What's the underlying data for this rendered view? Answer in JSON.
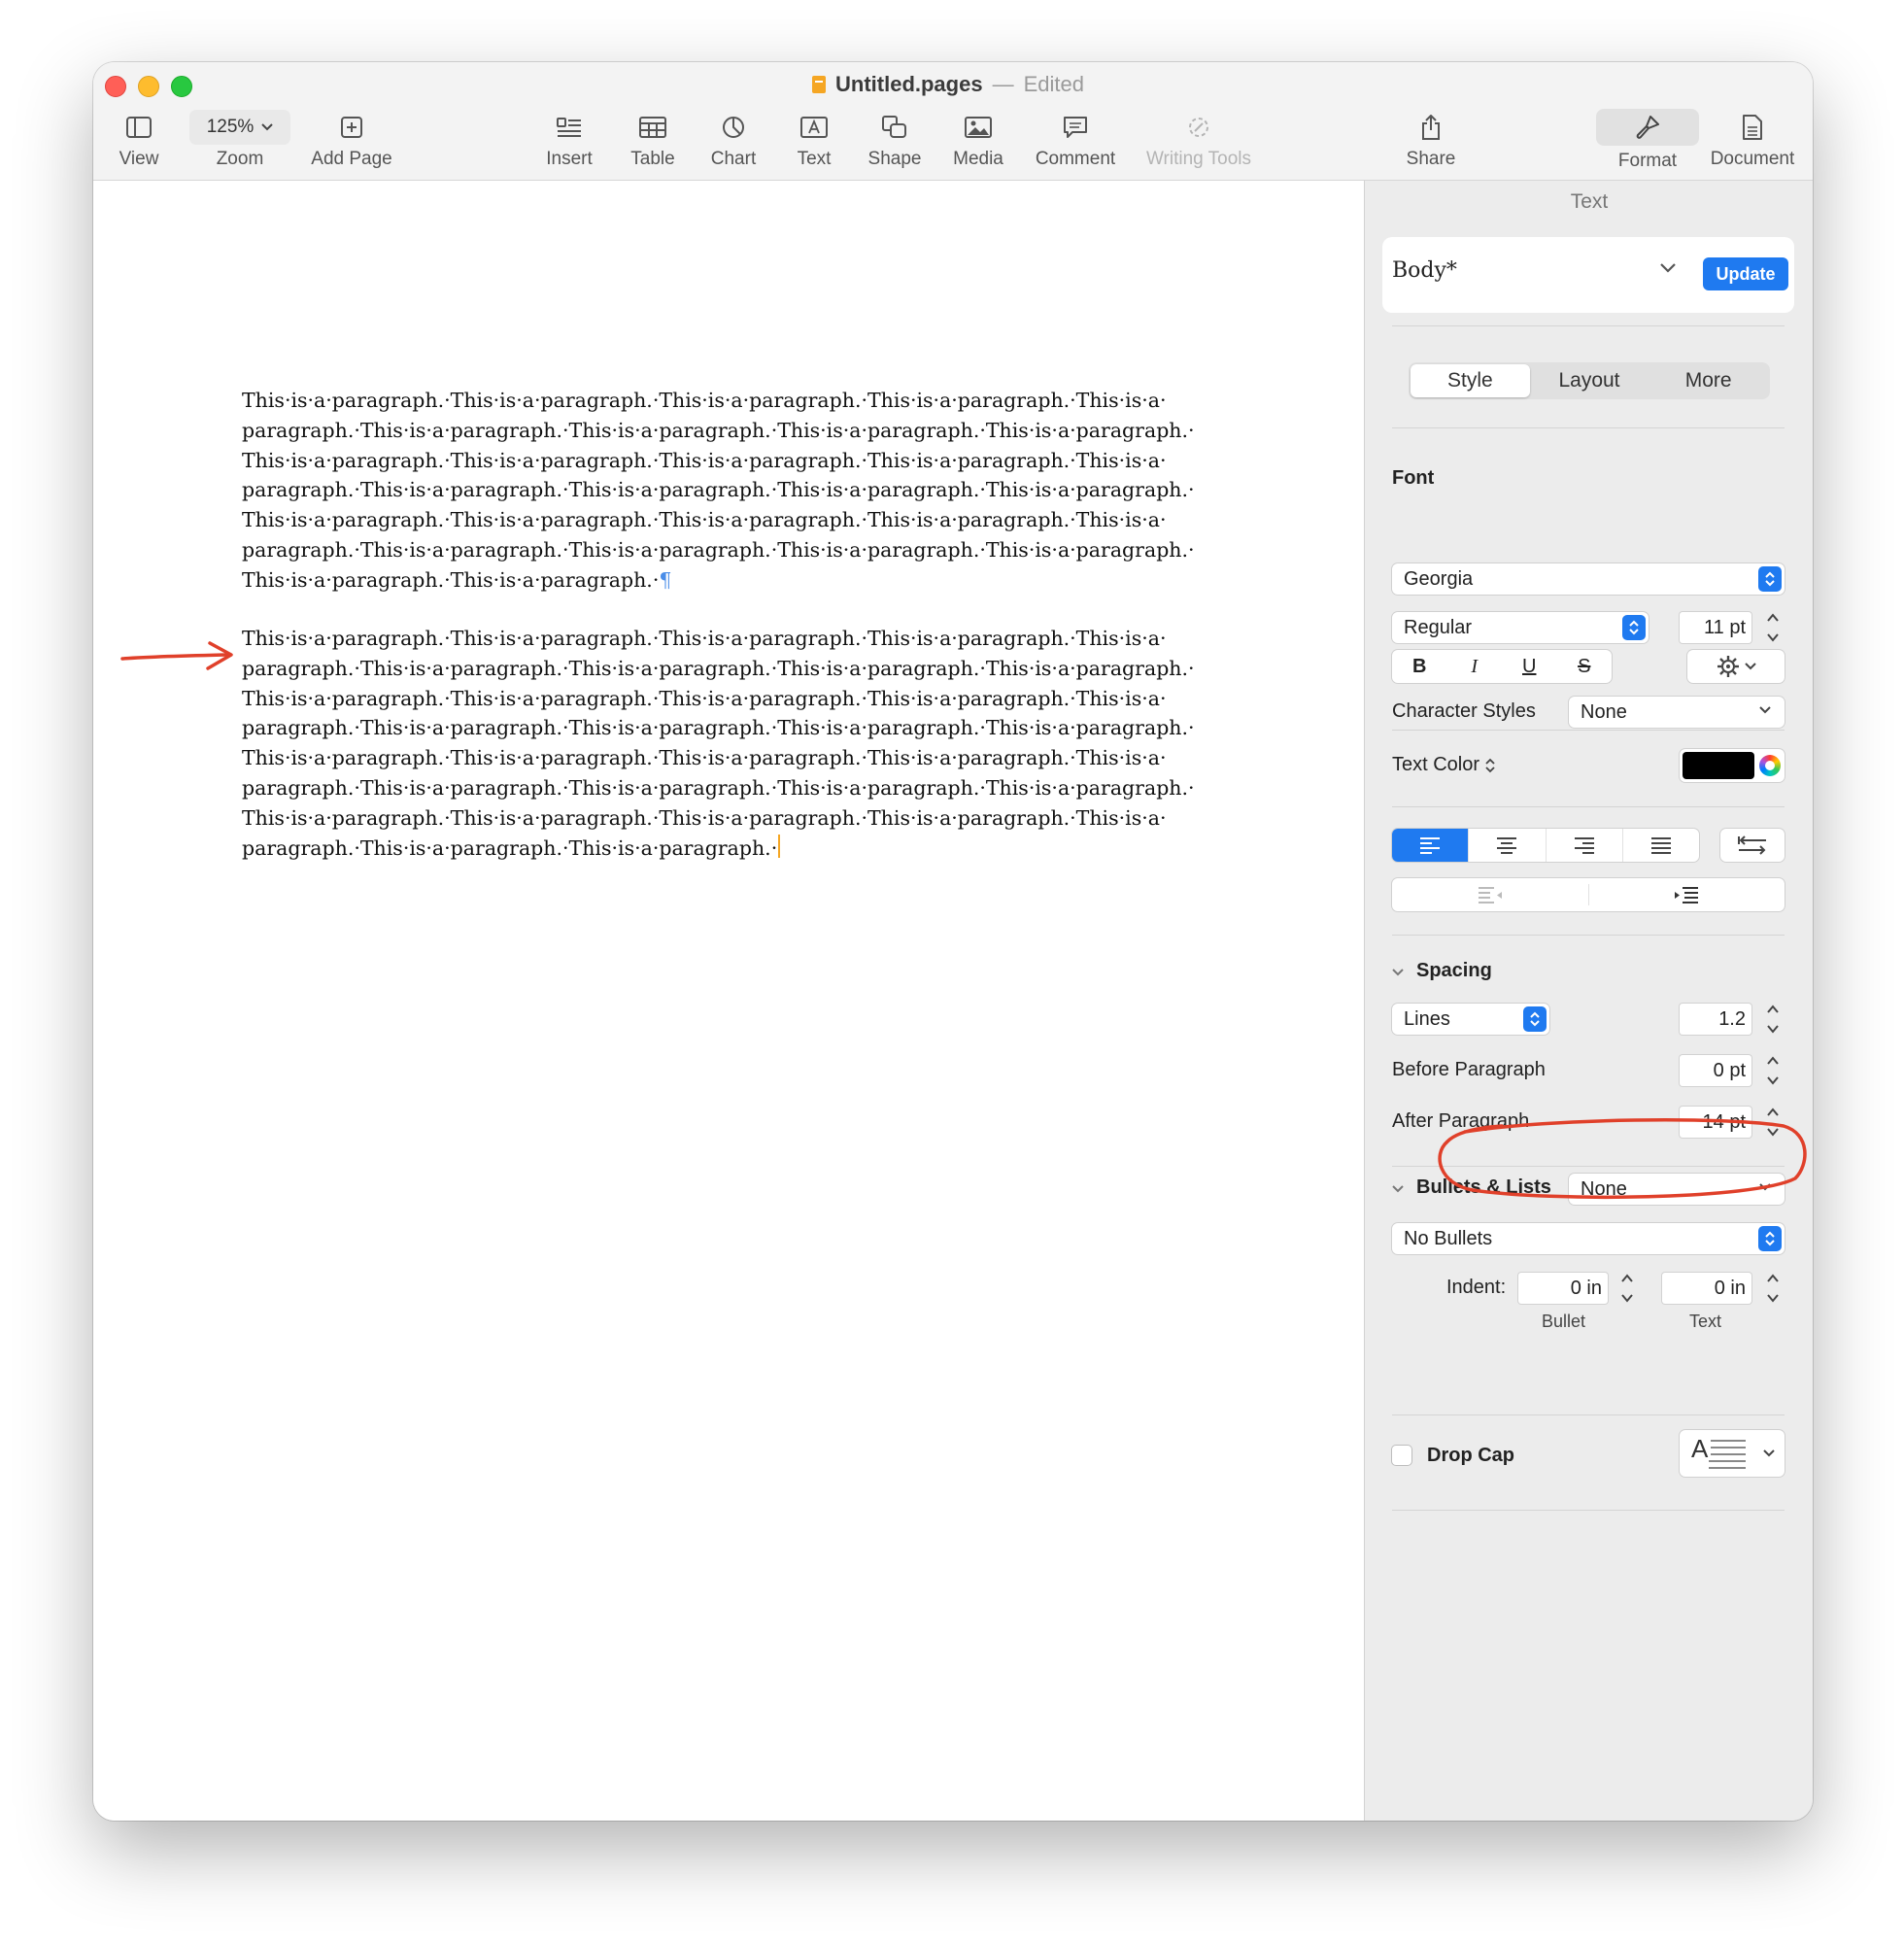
{
  "window": {
    "title": "Untitled.pages",
    "separator": "—",
    "status": "Edited"
  },
  "toolbar": {
    "view": "View",
    "zoom_value": "125%",
    "zoom": "Zoom",
    "add_page": "Add Page",
    "insert": "Insert",
    "table": "Table",
    "chart": "Chart",
    "text": "Text",
    "shape": "Shape",
    "media": "Media",
    "comment": "Comment",
    "writing_tools": "Writing Tools",
    "share": "Share",
    "format": "Format",
    "document": "Document"
  },
  "document": {
    "paragraph1": [
      "This·is·a·paragraph.·This·is·a·paragraph.·This·is·a·paragraph.·This·is·a·paragraph.·This·is·a·",
      "paragraph.·This·is·a·paragraph.·This·is·a·paragraph.·This·is·a·paragraph.·This·is·a·paragraph.·",
      "This·is·a·paragraph.·This·is·a·paragraph.·This·is·a·paragraph.·This·is·a·paragraph.·This·is·a·",
      "paragraph.·This·is·a·paragraph.·This·is·a·paragraph.·This·is·a·paragraph.·This·is·a·paragraph.·",
      "This·is·a·paragraph.·This·is·a·paragraph.·This·is·a·paragraph.·This·is·a·paragraph.·This·is·a·",
      "paragraph.·This·is·a·paragraph.·This·is·a·paragraph.·This·is·a·paragraph.·This·is·a·paragraph.·",
      "This·is·a·paragraph.·This·is·a·paragraph.·"
    ],
    "pilcrow": "¶",
    "paragraph2": [
      "This·is·a·paragraph.·This·is·a·paragraph.·This·is·a·paragraph.·This·is·a·paragraph.·This·is·a·",
      "paragraph.·This·is·a·paragraph.·This·is·a·paragraph.·This·is·a·paragraph.·This·is·a·paragraph.·",
      "This·is·a·paragraph.·This·is·a·paragraph.·This·is·a·paragraph.·This·is·a·paragraph.·This·is·a·",
      "paragraph.·This·is·a·paragraph.·This·is·a·paragraph.·This·is·a·paragraph.·This·is·a·paragraph.·",
      "This·is·a·paragraph.·This·is·a·paragraph.·This·is·a·paragraph.·This·is·a·paragraph.·This·is·a·",
      "paragraph.·This·is·a·paragraph.·This·is·a·paragraph.·This·is·a·paragraph.·This·is·a·paragraph.·",
      "This·is·a·paragraph.·This·is·a·paragraph.·This·is·a·paragraph.·This·is·a·paragraph.·This·is·a·",
      "paragraph.·This·is·a·paragraph.·This·is·a·paragraph.·"
    ]
  },
  "inspector": {
    "title": "Text",
    "paragraph_style": "Body*",
    "update": "Update",
    "tabs": [
      "Style",
      "Layout",
      "More"
    ],
    "font_label": "Font",
    "font_family": "Georgia",
    "font_style": "Regular",
    "font_size": "11 pt",
    "bold": "B",
    "italic": "I",
    "underline": "U",
    "strike": "S",
    "character_styles_label": "Character Styles",
    "character_styles_value": "None",
    "text_color_label": "Text Color",
    "text_color": "#000000",
    "spacing_label": "Spacing",
    "spacing_mode": "Lines",
    "line_spacing": "1.2",
    "before_paragraph_label": "Before Paragraph",
    "before_paragraph": "0 pt",
    "after_paragraph_label": "After Paragraph",
    "after_paragraph": "14 pt",
    "bullets_label": "Bullets & Lists",
    "bullets_value": "None",
    "bullet_type": "No Bullets",
    "indent_label": "Indent:",
    "bullet_indent": "0 in",
    "text_indent": "0 in",
    "bullet_caption": "Bullet",
    "text_caption": "Text",
    "drop_cap_label": "Drop Cap",
    "drop_cap_glyph": "A"
  },
  "annotations": {
    "arrow_color": "#e0402a",
    "circle_color": "#e0402a"
  },
  "colors": {
    "accent": "#1f7af0"
  }
}
